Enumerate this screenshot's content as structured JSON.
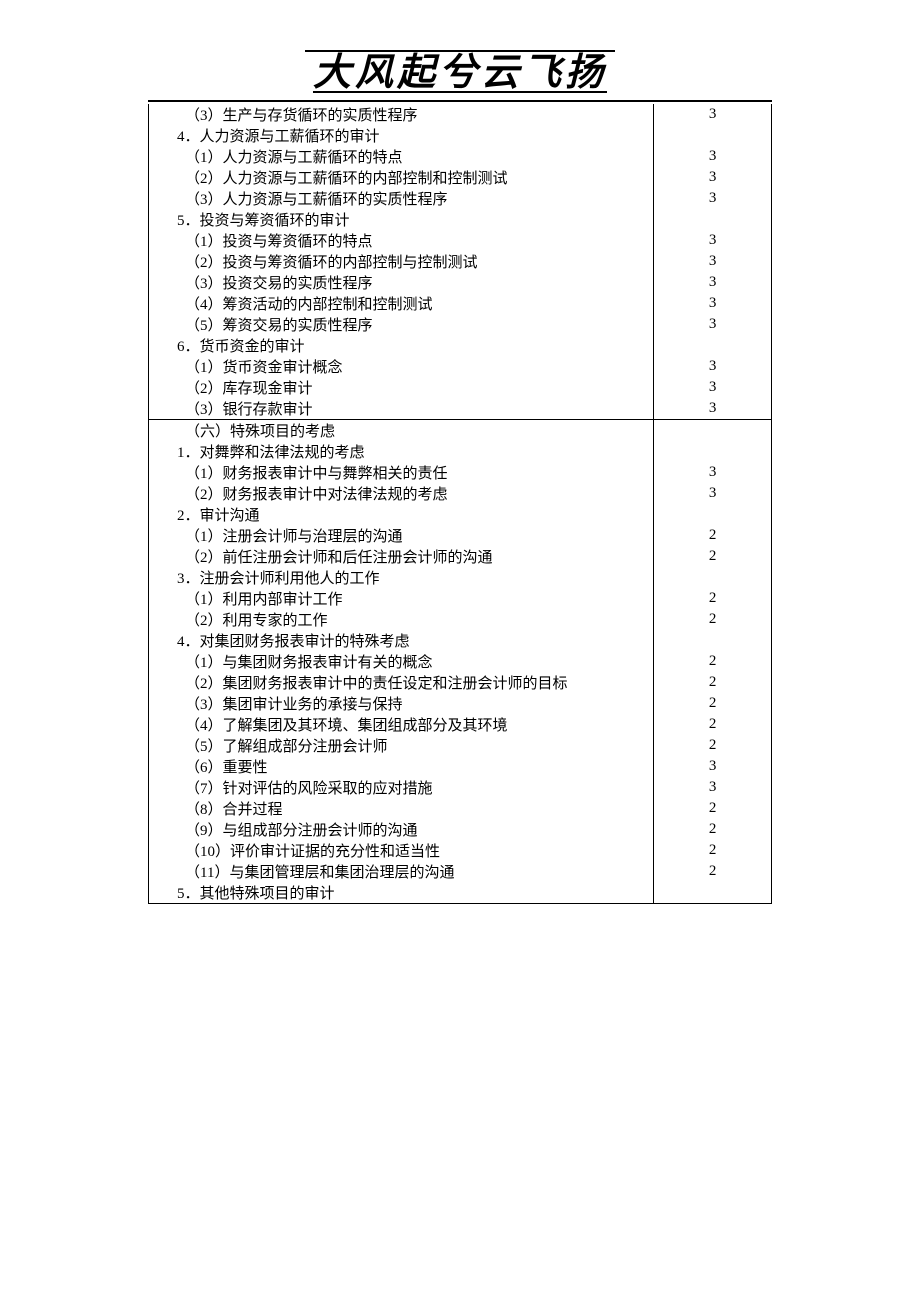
{
  "header": {
    "title": "大风起兮云飞扬"
  },
  "rows": [
    {
      "text": "（3）生产与存货循环的实质性程序",
      "num": "3",
      "indent": 1
    },
    {
      "text": "4．人力资源与工薪循环的审计",
      "num": "",
      "indent": 0
    },
    {
      "text": "（1）人力资源与工薪循环的特点",
      "num": "3",
      "indent": 1
    },
    {
      "text": "（2）人力资源与工薪循环的内部控制和控制测试",
      "num": "3",
      "indent": 1
    },
    {
      "text": "（3）人力资源与工薪循环的实质性程序",
      "num": "3",
      "indent": 1
    },
    {
      "text": "5．投资与筹资循环的审计",
      "num": "",
      "indent": 0
    },
    {
      "text": "（1）投资与筹资循环的特点",
      "num": "3",
      "indent": 1
    },
    {
      "text": "（2）投资与筹资循环的内部控制与控制测试",
      "num": "3",
      "indent": 1
    },
    {
      "text": "（3）投资交易的实质性程序",
      "num": "3",
      "indent": 1
    },
    {
      "text": "（4）筹资活动的内部控制和控制测试",
      "num": "3",
      "indent": 1
    },
    {
      "text": "（5）筹资交易的实质性程序",
      "num": "3",
      "indent": 1
    },
    {
      "text": "6．货币资金的审计",
      "num": "",
      "indent": 0
    },
    {
      "text": "（1）货币资金审计概念",
      "num": "3",
      "indent": 1
    },
    {
      "text": "（2）库存现金审计",
      "num": "3",
      "indent": 1
    },
    {
      "text": "（3）银行存款审计",
      "num": "3",
      "indent": 1,
      "divider": true
    },
    {
      "text": "（六）特殊项目的考虑",
      "num": "",
      "indent": 1
    },
    {
      "text": "1．对舞弊和法律法规的考虑",
      "num": "",
      "indent": 0
    },
    {
      "text": "（1）财务报表审计中与舞弊相关的责任",
      "num": "3",
      "indent": 1
    },
    {
      "text": "（2）财务报表审计中对法律法规的考虑",
      "num": "3",
      "indent": 1
    },
    {
      "text": "2．审计沟通",
      "num": "",
      "indent": 0
    },
    {
      "text": "（1）注册会计师与治理层的沟通",
      "num": "2",
      "indent": 1
    },
    {
      "text": "（2）前任注册会计师和后任注册会计师的沟通",
      "num": "2",
      "indent": 1
    },
    {
      "text": "3．注册会计师利用他人的工作",
      "num": "",
      "indent": 0
    },
    {
      "text": "（1）利用内部审计工作",
      "num": "2",
      "indent": 1
    },
    {
      "text": "（2）利用专家的工作",
      "num": "2",
      "indent": 1
    },
    {
      "text": "4．对集团财务报表审计的特殊考虑",
      "num": "",
      "indent": 0
    },
    {
      "text": "（1）与集团财务报表审计有关的概念",
      "num": "2",
      "indent": 1
    },
    {
      "text": "（2）集团财务报表审计中的责任设定和注册会计师的目标",
      "num": "2",
      "indent": 1
    },
    {
      "text": "（3）集团审计业务的承接与保持",
      "num": "2",
      "indent": 1
    },
    {
      "text": "（4）了解集团及其环境、集团组成部分及其环境",
      "num": "2",
      "indent": 1
    },
    {
      "text": "（5）了解组成部分注册会计师",
      "num": "2",
      "indent": 1
    },
    {
      "text": "（6）重要性",
      "num": "3",
      "indent": 1
    },
    {
      "text": "（7）针对评估的风险采取的应对措施",
      "num": "3",
      "indent": 1
    },
    {
      "text": "（8）合并过程",
      "num": "2",
      "indent": 1
    },
    {
      "text": "（9）与组成部分注册会计师的沟通",
      "num": "2",
      "indent": 1
    },
    {
      "text": "（10）评价审计证据的充分性和适当性",
      "num": "2",
      "indent": 1
    },
    {
      "text": "（11）与集团管理层和集团治理层的沟通",
      "num": "2",
      "indent": 1
    },
    {
      "text": "5．其他特殊项目的审计",
      "num": "",
      "indent": 0
    }
  ]
}
